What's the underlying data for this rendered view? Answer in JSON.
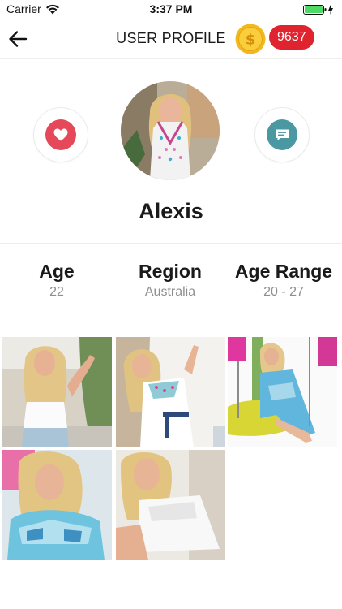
{
  "status_bar": {
    "carrier": "Carrier",
    "time": "3:37 PM",
    "battery_color": "#4cd964"
  },
  "header": {
    "back_icon": "arrow-left-icon",
    "title": "USER PROFILE",
    "coin_icon": "gold-coin-icon",
    "coins": "9637",
    "badge_color": "#e0242f"
  },
  "profile": {
    "name": "Alexis",
    "like_icon": "heart-icon",
    "like_color": "#e54858",
    "message_icon": "chat-bubble-icon",
    "message_color": "#4a98a2"
  },
  "stats": [
    {
      "label": "Age",
      "value": "22"
    },
    {
      "label": "Region",
      "value": "Australia"
    },
    {
      "label": "Age Range",
      "value": "20 - 27"
    }
  ],
  "gallery": {
    "photos": [
      {
        "name": "photo-1"
      },
      {
        "name": "photo-2"
      },
      {
        "name": "photo-3"
      },
      {
        "name": "photo-4"
      },
      {
        "name": "photo-5"
      }
    ]
  }
}
